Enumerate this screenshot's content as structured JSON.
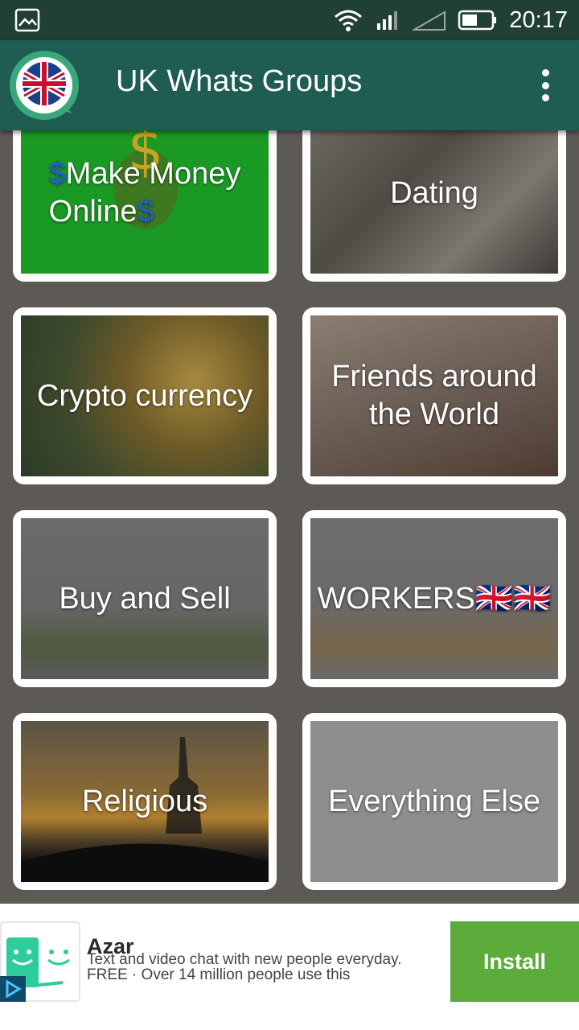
{
  "status_bar": {
    "time": "20:17"
  },
  "app_bar": {
    "title": "UK Whats Groups"
  },
  "categories": [
    {
      "label_line1": "Make Money",
      "label_line2": "Online"
    },
    {
      "label": "Dating"
    },
    {
      "label": "Crypto currency"
    },
    {
      "label": "Friends around the World"
    },
    {
      "label": "Buy and Sell"
    },
    {
      "label": "WORKERS🇬🇧🇬🇧"
    },
    {
      "label": "Religious"
    },
    {
      "label": "Everything Else"
    }
  ],
  "ad": {
    "title": "Azar",
    "description_line1": "Text and video chat with new people everyday.",
    "description_line2": "FREE · Over 14 million people use this",
    "cta": "Install"
  },
  "colors": {
    "app_bar": "#1f5c52",
    "status_bar": "#1f3f37",
    "install": "#5aab39",
    "make_money": "#1a9a25"
  }
}
